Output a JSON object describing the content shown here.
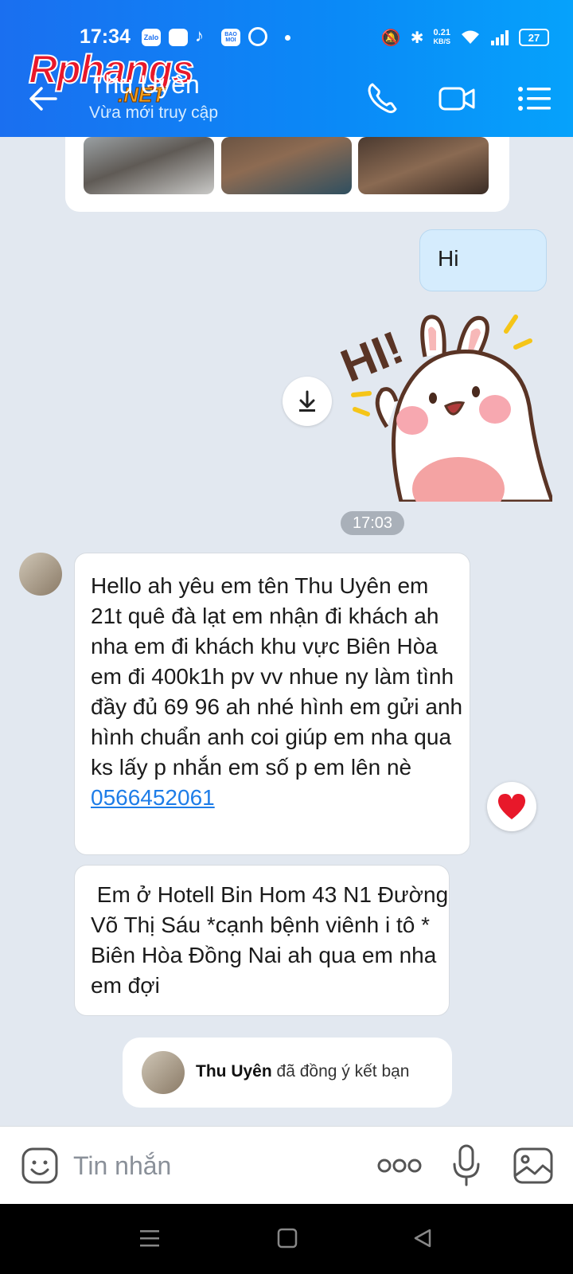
{
  "status_bar": {
    "time": "17:34",
    "net_speed": "0.21",
    "net_unit": "KB/S",
    "battery": "27",
    "apps": [
      "Zalo",
      "BAO MOI"
    ]
  },
  "watermark": {
    "brand": "Rphangs",
    "suffix": ".NET"
  },
  "header": {
    "contact_name": "Thu Uyên",
    "contact_status": "Vừa mới truy cập"
  },
  "messages": {
    "outgoing_hi": "Hi",
    "sticker_text": "HI!",
    "time_divider": "17:03",
    "incoming_1_text": "Hello ah yêu em tên Thu Uyên em 21t quê đà lạt em nhận đi khách ah nha em đi khách khu vực Biên Hòa  em đi 400k1h pv vv nhue ny làm tình đầy đủ 69 96 ah nhé hình em gửi anh hình chuẩn anh coi giúp em nha qua ks lấy p nhắn em số p em lên nè",
    "incoming_1_phone": "0566452061",
    "incoming_2_text": " Em ở Hotell Bin Hom 43 N1 Đường Võ Thị Sáu *cạnh bệnh viênh i tô * Biên Hòa Đồng Nai ah qua em nha em đợi"
  },
  "friend_notice": {
    "name": "Thu Uyên",
    "text": "đã đồng ý kết bạn"
  },
  "input": {
    "placeholder": "Tin nhắn"
  },
  "colors": {
    "header_blue": "#0a8af7",
    "link": "#1e7de8",
    "bubble_out": "#d5ecfd",
    "reaction": "#e8182a"
  }
}
